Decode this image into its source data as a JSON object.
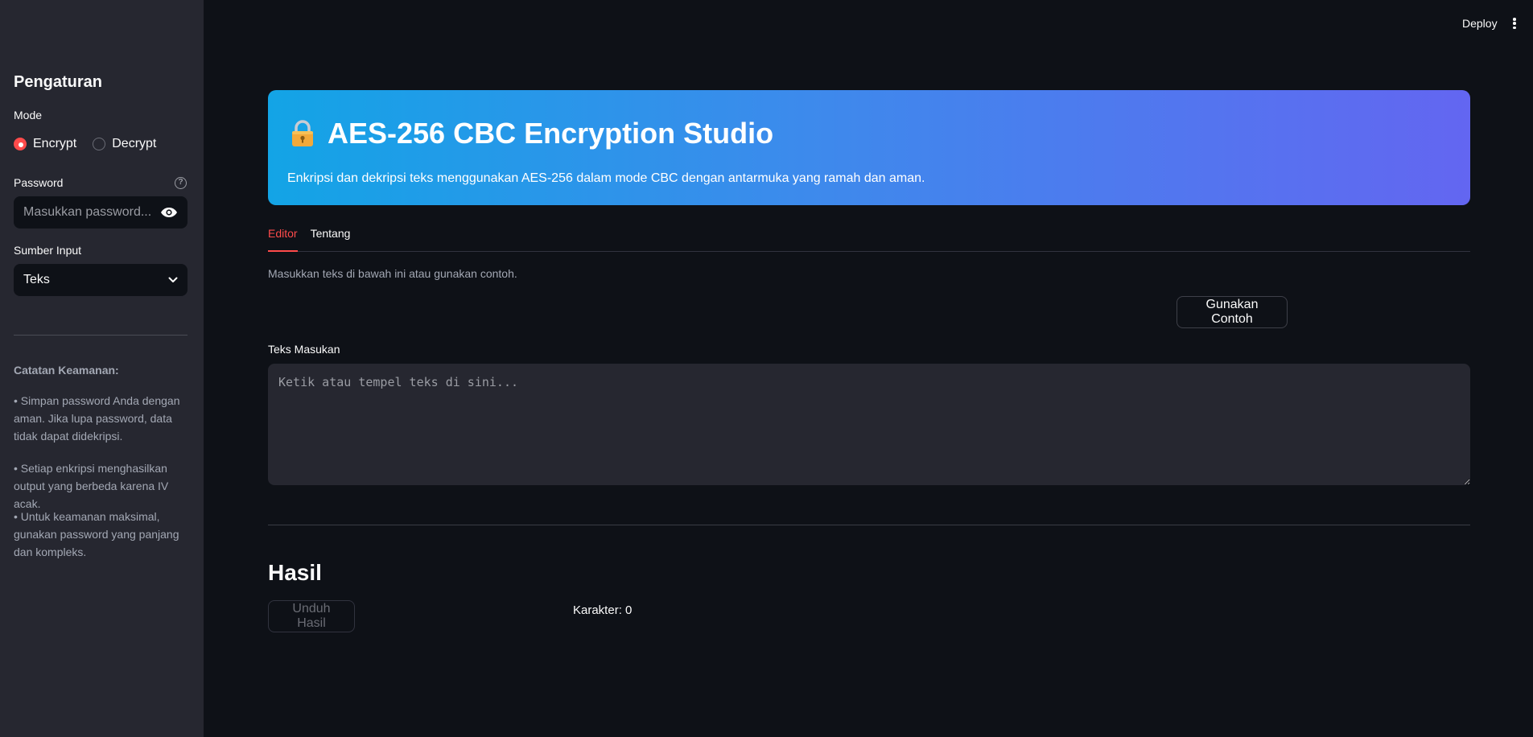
{
  "header": {
    "deploy_label": "Deploy",
    "menu_icon": "kebab-menu-icon"
  },
  "sidebar": {
    "title": "Pengaturan",
    "mode_label": "Mode",
    "mode_options": [
      {
        "label": "Encrypt",
        "selected": true
      },
      {
        "label": "Decrypt",
        "selected": false
      }
    ],
    "password_label": "Password",
    "password_placeholder": "Masukkan password...",
    "password_value": "",
    "source_label": "Sumber Input",
    "source_selected": "Teks",
    "security_title": "Catatan Keamanan:",
    "security_notes": [
      "• Simpan password Anda dengan aman. Jika lupa password, data tidak dapat didekripsi.",
      "• Setiap enkripsi menghasilkan output yang berbeda karena IV acak.",
      "• Untuk keamanan maksimal, gunakan password yang panjang dan kompleks."
    ]
  },
  "hero": {
    "icon": "lock-icon",
    "title": "AES-256 CBC Encryption Studio",
    "subtitle": "Enkripsi dan dekripsi teks menggunakan AES-256 dalam mode CBC dengan antarmuka yang ramah dan aman."
  },
  "tabs": [
    {
      "label": "Editor",
      "active": true
    },
    {
      "label": "Tentang",
      "active": false
    }
  ],
  "editor": {
    "hint": "Masukkan teks di bawah ini atau gunakan contoh.",
    "example_button": "Gunakan Contoh",
    "input_label": "Teks Masukan",
    "input_placeholder": "Ketik atau tempel teks di sini...",
    "input_value": ""
  },
  "result": {
    "title": "Hasil",
    "download_button": "Unduh Hasil",
    "char_count": "Karakter: 0"
  },
  "colors": {
    "accent": "#ff4b4b",
    "background": "#0e1117",
    "sidebar": "#262730",
    "hero_gradient_start": "#13a4e6",
    "hero_gradient_end": "#6366f1"
  }
}
